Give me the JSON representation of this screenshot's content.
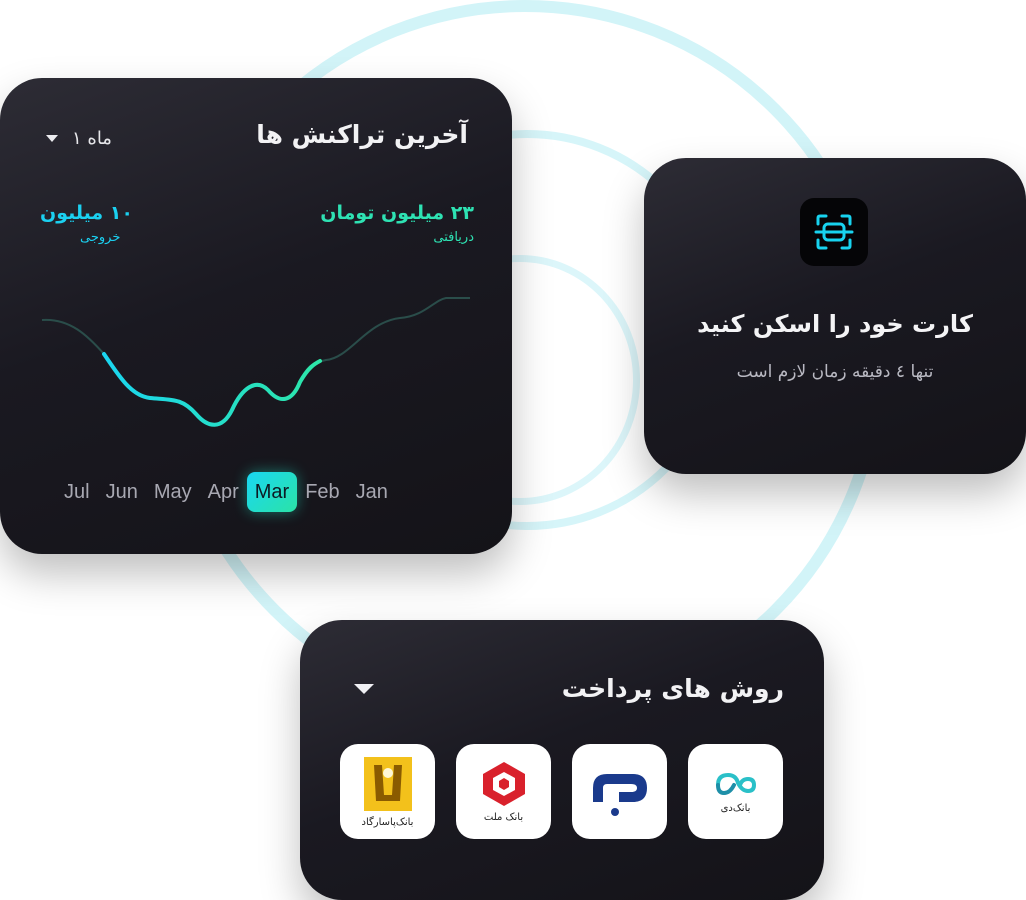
{
  "colors": {
    "accent_in": "#2ee2b3",
    "accent_out": "#1bd0f0",
    "card_bg": "#1a1921",
    "ring": "#d2f4f8"
  },
  "transactions": {
    "title": "آخرین تراکنش ها",
    "period_label": "۱ ماه",
    "income": {
      "amount": "۲۳ میلیون تومان",
      "label": "دریافتی"
    },
    "outgoing": {
      "amount": "۱۰ میلیون",
      "label": "خروجی"
    },
    "months": [
      "Jul",
      "Jun",
      "May",
      "Apr",
      "Mar",
      "Feb",
      "Jan"
    ],
    "selected_month": "Mar"
  },
  "scan": {
    "icon": "scan-card-icon",
    "title": "کارت خود را اسکن کنید",
    "subtitle": "تنها ٤ دقیقه زمان لازم است"
  },
  "payment": {
    "title": "روش های پرداخت",
    "banks": [
      {
        "icon": "bank-pasargad-logo",
        "name": "بانک‌پاسارگاد"
      },
      {
        "icon": "bank-mellat-logo",
        "name": "بانک ملت"
      },
      {
        "icon": "bank-saderat-logo",
        "name": ""
      },
      {
        "icon": "bank-day-logo",
        "name": "بانک‌دی"
      }
    ]
  }
}
